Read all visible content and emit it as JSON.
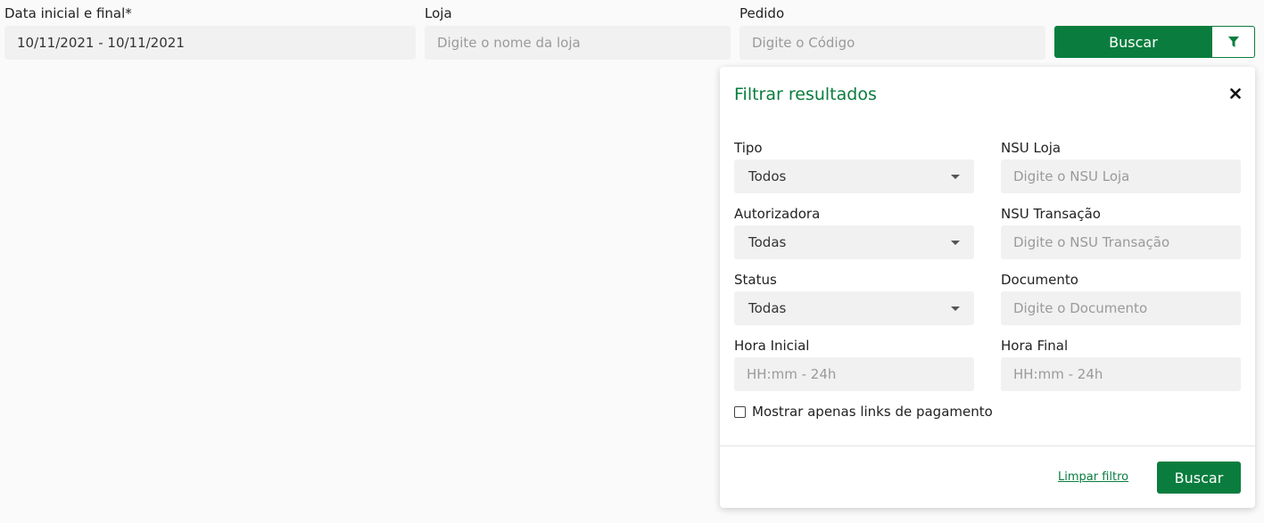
{
  "colors": {
    "accent": "#0a7d3e",
    "field_bg": "#f1f1f1",
    "placeholder": "#9a9a9a"
  },
  "search_bar": {
    "date_label": "Data inicial e final*",
    "date_value": "10/11/2021 - 10/11/2021",
    "store_label": "Loja",
    "store_placeholder": "Digite o nome da loja",
    "order_label": "Pedido",
    "order_placeholder": "Digite o Código",
    "search_button": "Buscar",
    "filter_icon": "filter-icon"
  },
  "filter_panel": {
    "title": "Filtrar resultados",
    "close_icon": "close-icon",
    "tipo_label": "Tipo",
    "tipo_value": "Todos",
    "nsu_loja_label": "NSU Loja",
    "nsu_loja_placeholder": "Digite o NSU Loja",
    "autorizadora_label": "Autorizadora",
    "autorizadora_value": "Todas",
    "nsu_transacao_label": "NSU Transação",
    "nsu_transacao_placeholder": "Digite o NSU Transação",
    "status_label": "Status",
    "status_value": "Todas",
    "documento_label": "Documento",
    "documento_placeholder": "Digite o Documento",
    "hora_inicial_label": "Hora Inicial",
    "hora_inicial_placeholder": "HH:mm - 24h",
    "hora_final_label": "Hora Final",
    "hora_final_placeholder": "HH:mm - 24h",
    "checkbox_label": "Mostrar apenas links de pagamento",
    "checkbox_checked": false,
    "clear_link": "Limpar filtro",
    "search_button": "Buscar"
  }
}
